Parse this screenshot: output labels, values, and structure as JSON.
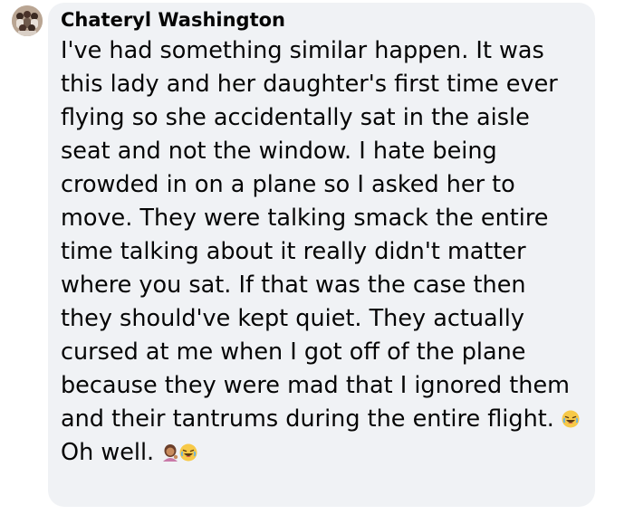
{
  "comment": {
    "author": "Chateryl Washington",
    "text_main": "I've had something similar happen. It was this lady and her daughter's first time ever flying so she accidentally sat in the aisle seat and not the window. I hate being crowded in on a plane so I asked her to move. They were talking smack the entire time talking about it really didn't matter where you sat. If that was the case then they should've kept quiet. They actually cursed at me when I got off of the plane because they were mad that I ignored them and their tantrums during the entire flight.",
    "text_after_emoji": "Oh well.",
    "emojis": [
      "face-with-tears-of-joy",
      "woman-tipping-hand",
      "face-with-tears-of-joy"
    ]
  },
  "colors": {
    "bubble_background": "#f0f2f5",
    "text": "#050505"
  }
}
